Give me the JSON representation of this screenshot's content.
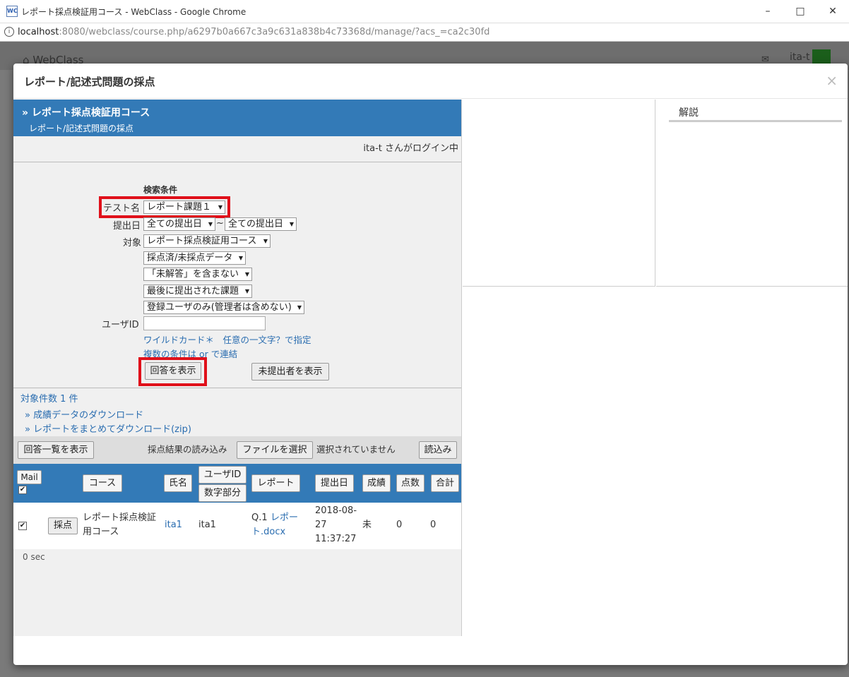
{
  "window": {
    "favicon": "WC",
    "title": "レポート採点検証用コース - WebClass - Google Chrome"
  },
  "address": {
    "info_icon": "i",
    "host": "localhost",
    "rest": ":8080/webclass/course.php/a6297b0a667c3a9c631a838b4c73368d/manage/?acs_=ca2c30fd"
  },
  "bg": {
    "home_label": "WebClass",
    "user": "ita-t"
  },
  "modal": {
    "title": "レポート/記述式問題の採点",
    "close": "×"
  },
  "left": {
    "course_title": "» レポート採点検証用コース",
    "course_sub": "レポート/記述式問題の採点",
    "login_status": "ita-t さんがログイン中",
    "search_heading": "検索条件",
    "test_label": "テスト名",
    "test_value": "レポート課題１",
    "date_label": "提出日",
    "date_from": "全ての提出日",
    "date_sep": "~",
    "date_to": "全ての提出日",
    "target_label": "対象",
    "target_value": "レポート採点検証用コース",
    "filter_graded": "採点済/未採点データ",
    "filter_unanswered": "「未解答」を含まない",
    "filter_last": "最後に提出された課題",
    "filter_users": "登録ユーザのみ(管理者は含めない)",
    "userid_label": "ユーザID",
    "userid_value": "",
    "hint_wildcard": "ワイルドカード＊　任意の一文字？で指定",
    "hint_or": "複数の条件は or で連結",
    "show_answers_btn": "回答を表示",
    "show_nonsubmit_btn": "未提出者を表示",
    "count_text": "対象件数 1 件",
    "dl_grades": "» 成績データのダウンロード",
    "dl_reports": "» レポートをまとめてダウンロード(zip)",
    "toolbar": {
      "list_btn": "回答一覧を表示",
      "import_label": "採点結果の読み込み",
      "file_btn": "ファイルを選択",
      "file_status": "選択されていません",
      "load_btn": "読込み"
    },
    "table": {
      "headers": {
        "mail": "Mail",
        "course": "コース",
        "name": "氏名",
        "userid": "ユーザID",
        "numpart": "数字部分",
        "report": "レポート",
        "date": "提出日",
        "grade": "成績",
        "points": "点数",
        "total": "合計"
      },
      "rows": [
        {
          "grade_btn": "採点",
          "course_l1": "レポート採点検証",
          "course_l2": "用コース",
          "name": "ita1",
          "userid": "ita1",
          "q": "Q.1",
          "report_l1": "レポー",
          "report_l2": "ト.docx",
          "date_l1": "2018-08-",
          "date_l2": "27",
          "date_l3": "11:37:27",
          "grade": "未",
          "points": "0",
          "total": "0"
        }
      ]
    },
    "elapsed": "0 sec"
  },
  "right": {
    "commentary": "解説"
  }
}
